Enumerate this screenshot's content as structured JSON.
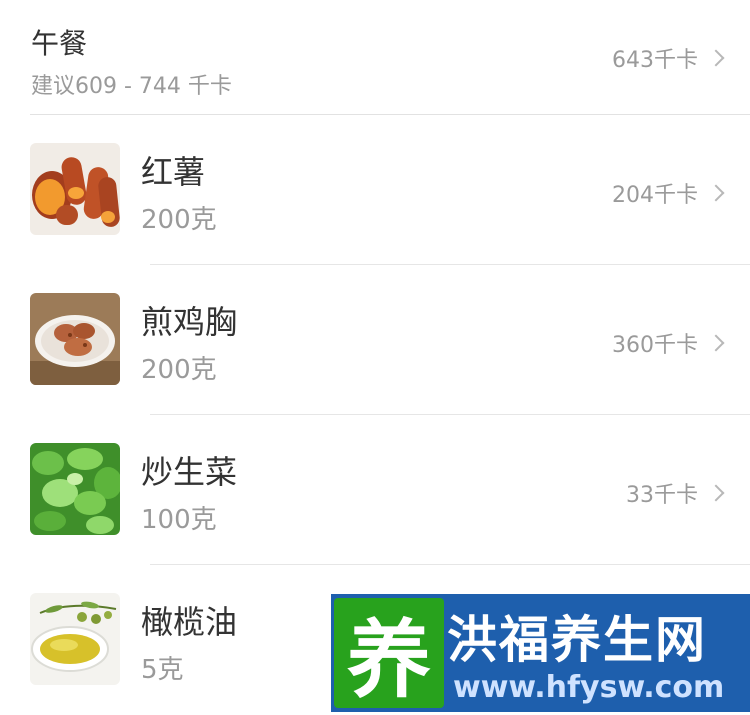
{
  "meal": {
    "title": "午餐",
    "suggestion": "建议609 - 744 千卡",
    "total": "643千卡"
  },
  "items": [
    {
      "name": "红薯",
      "amount": "200克",
      "kcal": "204千卡",
      "icon": "sweet-potato-photo"
    },
    {
      "name": "煎鸡胸",
      "amount": "200克",
      "kcal": "360千卡",
      "icon": "chicken-breast-photo"
    },
    {
      "name": "炒生菜",
      "amount": "100克",
      "kcal": "33千卡",
      "icon": "lettuce-photo"
    },
    {
      "name": "橄榄油",
      "amount": "5克",
      "kcal": "",
      "icon": "olive-oil-photo"
    }
  ],
  "watermark": {
    "char": "养",
    "title": "洪福养生网",
    "url": "www.hfysw.com"
  },
  "colors": {
    "text_primary": "#333333",
    "text_secondary": "#9a9a9a",
    "divider": "#e2e2e2",
    "watermark_bg": "#1e5fad",
    "watermark_accent": "#28a21d"
  }
}
